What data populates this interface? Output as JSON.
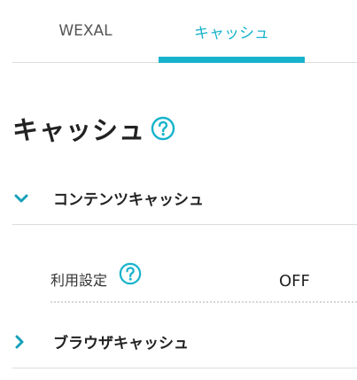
{
  "tabs": [
    {
      "label": "WEXAL",
      "active": false
    },
    {
      "label": "キャッシュ",
      "active": true
    }
  ],
  "page": {
    "title": "キャッシュ",
    "help_icon": "question-circle-icon"
  },
  "sections": {
    "content_cache": {
      "label": "コンテンツキャッシュ",
      "expanded": true,
      "chevron_icon": "chevron-down-icon",
      "settings": {
        "usage_label": "利用設定",
        "usage_value": "OFF",
        "help_icon": "question-circle-icon"
      }
    },
    "browser_cache": {
      "label": "ブラウザキャッシュ",
      "expanded": false,
      "chevron_icon": "chevron-right-icon"
    }
  },
  "colors": {
    "accent": "#17b3cc",
    "text": "#222222",
    "divider": "#dcdcdc"
  }
}
